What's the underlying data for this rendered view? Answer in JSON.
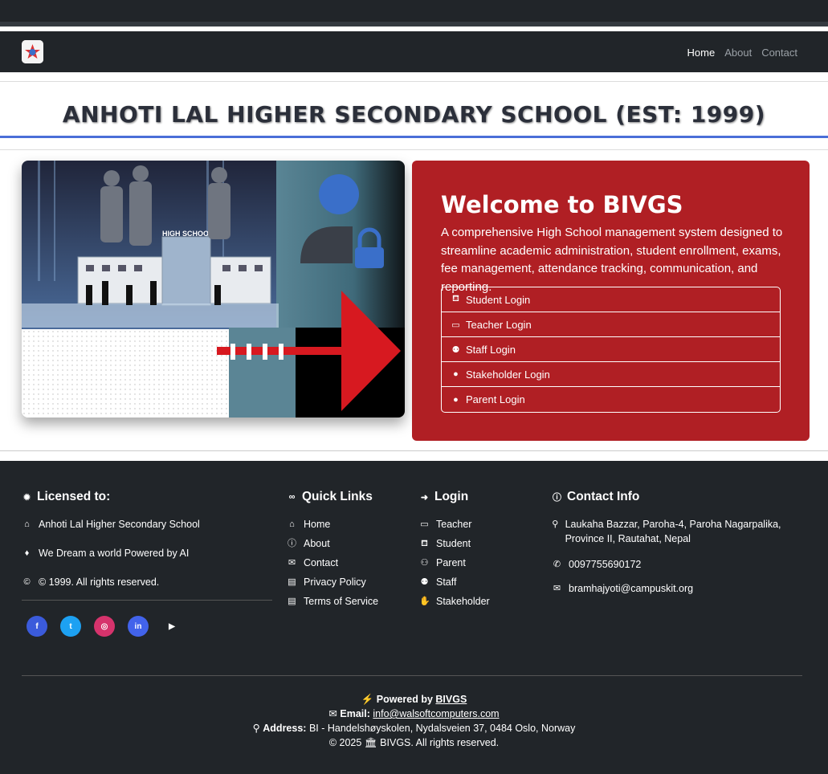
{
  "nav": {
    "home": "Home",
    "about": "About",
    "contact": "Contact"
  },
  "school_title": "ANHOTI LAL HIGHER SECONDARY SCHOOL (EST: 1999)",
  "hero": {
    "sign_text": "HIGH SCHOOL"
  },
  "welcome": {
    "heading": "Welcome to BIVGS",
    "text": "A comprehensive High School management system designed to streamline academic administration, student enrollment, exams, fee management, attendance tracking, communication, and reporting.",
    "logins": [
      "Student Login",
      "Teacher Login",
      "Staff Login",
      "Stakeholder Login",
      "Parent Login"
    ]
  },
  "footer": {
    "licensed": {
      "heading": "Licensed to:",
      "school": "Anhoti Lal Higher Secondary School",
      "tagline": "We Dream a world Powered by AI",
      "copyright": "© 1999. All rights reserved."
    },
    "quick_links": {
      "heading": "Quick Links",
      "items": [
        "Home",
        "About",
        "Contact",
        "Privacy Policy",
        "Terms of Service"
      ]
    },
    "login": {
      "heading": "Login",
      "items": [
        "Teacher",
        "Student",
        "Parent",
        "Staff",
        "Stakeholder"
      ]
    },
    "contact": {
      "heading": "Contact Info",
      "address": "Laukaha Bazzar, Paroha-4, Paroha Nagarpalika, Province II, Rautahat, Nepal",
      "phone": "0097755690172",
      "email": "bramhajyoti@campuskit.org"
    },
    "social_icons": [
      "facebook-icon",
      "twitter-icon",
      "instagram-icon",
      "linkedin-icon",
      "youtube-icon"
    ],
    "powered_label": "Powered by",
    "powered_name": "BIVGS",
    "email_label": "Email:",
    "email_value": "info@walsoftcomputers.com",
    "address_label": "Address:",
    "address_value": "BI - Handelshøyskolen, Nydalsveien 37, 0484 Oslo, Norway",
    "copyright_prefix": "© 2025",
    "copyright_suffix": "BIVGS. All rights reserved."
  },
  "colors": {
    "dark": "#212529",
    "accent_red": "#b01f24",
    "title_line": "#4a6fd8"
  }
}
